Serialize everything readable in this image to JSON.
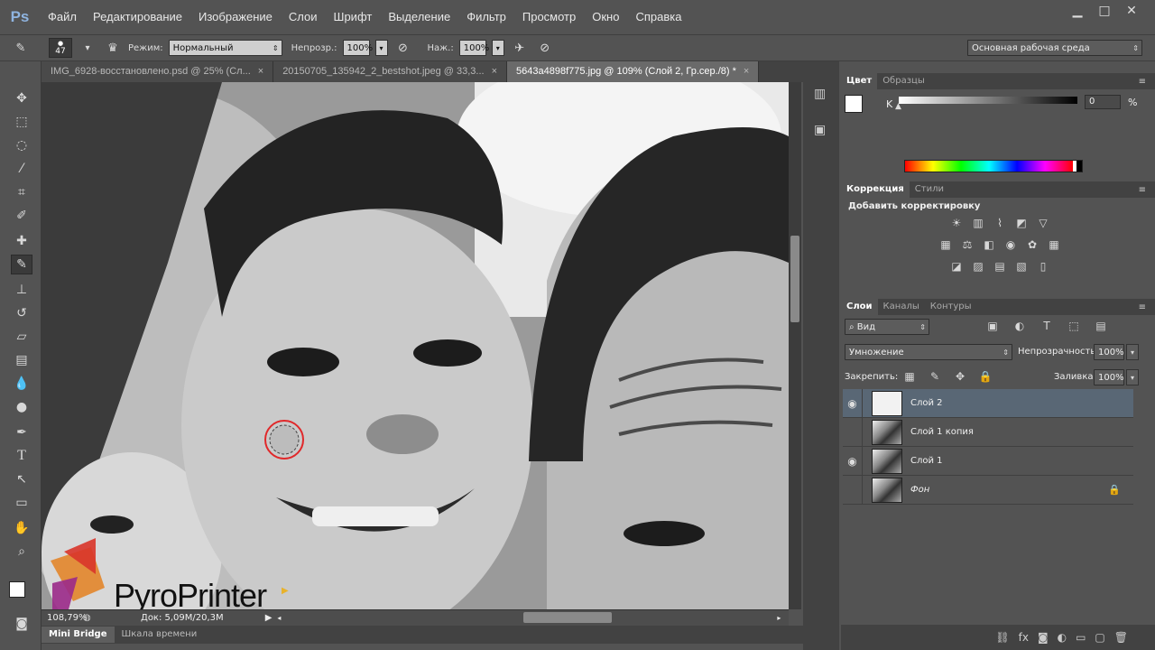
{
  "app": {
    "logo": "Ps"
  },
  "menu": [
    "Файл",
    "Редактирование",
    "Изображение",
    "Слои",
    "Шрифт",
    "Выделение",
    "Фильтр",
    "Просмотр",
    "Окно",
    "Справка"
  ],
  "window_buttons": [
    "▁",
    "□",
    "✕"
  ],
  "options": {
    "brush_size": "47",
    "mode_label": "Режим:",
    "mode_value": "Нормальный",
    "opacity_label": "Непрозр.:",
    "opacity_value": "100%",
    "pressure_label": "Наж.:",
    "pressure_value": "100%",
    "workspace": "Основная рабочая среда"
  },
  "tabs": [
    {
      "label": "IMG_6928-восстановлено.psd @ 25% (Сл...",
      "close": "×"
    },
    {
      "label": "20150705_135942_2_bestshot.jpeg @ 33,3...",
      "close": "×"
    },
    {
      "label": "5643a4898f775.jpg @ 109% (Слой 2, Гр.сер./8) *",
      "close": "×"
    }
  ],
  "status": {
    "zoom": "108,79%",
    "doc": "Док: 5,09M/20,3M"
  },
  "watermark": "PyroPrinter",
  "bottom_tabs": [
    "Mini Bridge",
    "Шкала времени"
  ],
  "color_panel": {
    "tabs": [
      "Цвет",
      "Образцы"
    ],
    "channel": "K",
    "value": "0",
    "unit": "%"
  },
  "adjust_panel": {
    "tabs": [
      "Коррекция",
      "Стили"
    ],
    "title": "Добавить корректировку"
  },
  "layers_panel": {
    "tabs": [
      "Слои",
      "Каналы",
      "Контуры"
    ],
    "filter": "Вид",
    "blend_mode": "Умножение",
    "opacity_label": "Непрозрачность:",
    "opacity_value": "100%",
    "lock_label": "Закрепить:",
    "fill_label": "Заливка:",
    "fill_value": "100%",
    "layers": [
      {
        "name": "Слой 2",
        "visible": true,
        "selected": true
      },
      {
        "name": "Слой 1 копия",
        "visible": false,
        "selected": false
      },
      {
        "name": "Слой 1",
        "visible": true,
        "selected": false
      },
      {
        "name": "Фон",
        "visible": false,
        "selected": false,
        "locked": true
      }
    ]
  },
  "colors": {
    "accent": "#596775",
    "brush_circle": "#e0282a"
  }
}
